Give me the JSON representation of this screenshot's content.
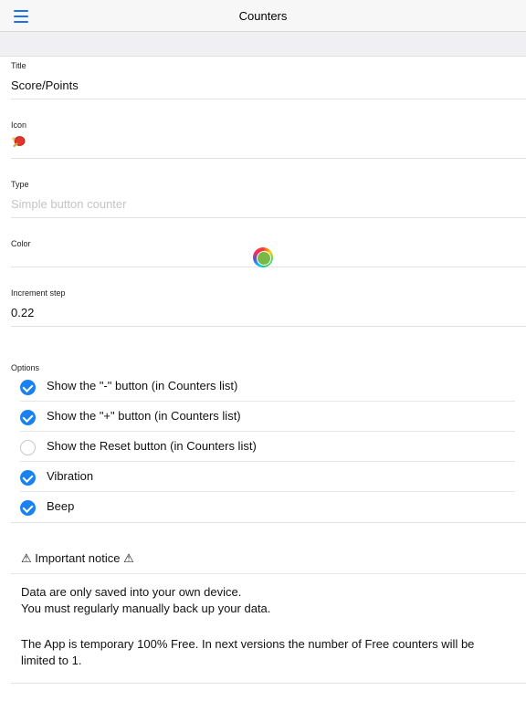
{
  "header": {
    "title": "Counters",
    "menu_icon": "hamburger-menu-icon",
    "accent": "#1a73e8"
  },
  "form": {
    "title": {
      "label": "Title",
      "value": "Score/Points"
    },
    "icon": {
      "label": "Icon",
      "value": "🏓",
      "icon_name": "ping-pong-paddle-icon"
    },
    "type": {
      "label": "Type",
      "placeholder": "Simple button counter"
    },
    "color": {
      "label": "Color",
      "value": "#7ab845"
    },
    "increment": {
      "label": "Increment step",
      "value": "0.22"
    }
  },
  "options": {
    "label": "Options",
    "items": [
      {
        "label": "Show the \"-\" button (in Counters list)",
        "checked": true
      },
      {
        "label": "Show the \"+\" button (in Counters list)",
        "checked": true
      },
      {
        "label": "Show the Reset button (in Counters list)",
        "checked": false
      },
      {
        "label": "Vibration",
        "checked": true
      },
      {
        "label": "Beep",
        "checked": true
      }
    ]
  },
  "notice": {
    "title": "⚠ Important notice ⚠",
    "line1": "Data are only saved into your own device.",
    "line2": "You must regularly manually back up your data.",
    "line3": "The App is temporary 100% Free. In next versions the number of Free counters will be limited to 1."
  },
  "colors": {
    "check_on": "#1a82f0",
    "check_off_border": "#c8c8c8"
  }
}
